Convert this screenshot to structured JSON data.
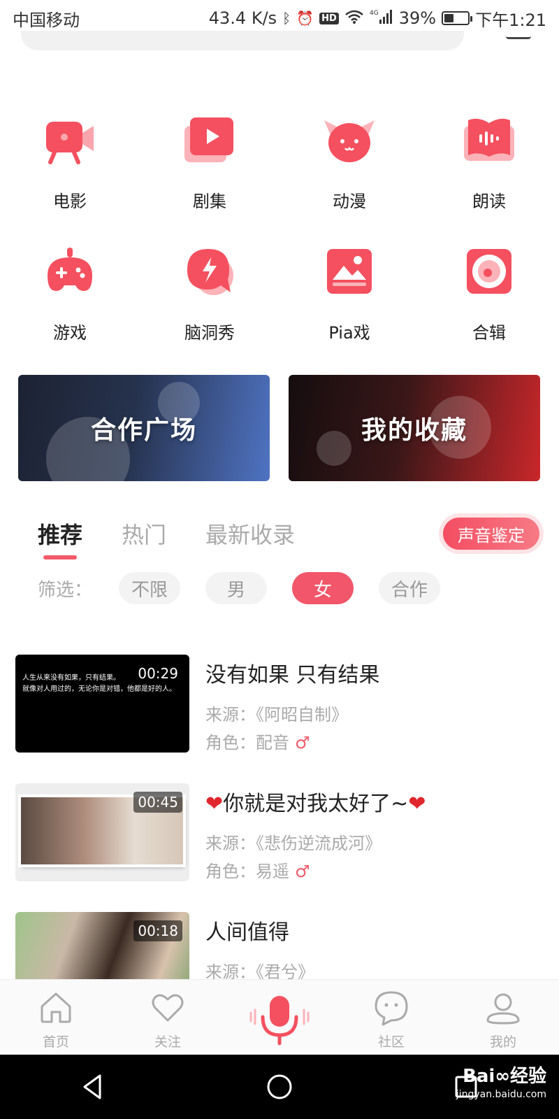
{
  "status_bar": {
    "carrier": "中国移动",
    "speed": "43.4 K/s",
    "hd": "HD",
    "signal_type": "4G",
    "battery": "39%",
    "battery_level": 0.39,
    "time": "下午1:21"
  },
  "categories": [
    {
      "label": "电影",
      "icon": "movie-camera-icon"
    },
    {
      "label": "剧集",
      "icon": "play-icon"
    },
    {
      "label": "动漫",
      "icon": "cat-face-icon"
    },
    {
      "label": "朗读",
      "icon": "book-audio-icon"
    },
    {
      "label": "游戏",
      "icon": "gamepad-icon"
    },
    {
      "label": "脑洞秀",
      "icon": "lightning-bubble-icon"
    },
    {
      "label": "Pia戏",
      "icon": "picture-icon"
    },
    {
      "label": "合辑",
      "icon": "disc-icon"
    }
  ],
  "banners": {
    "cooperation": "合作广场",
    "favorites": "我的收藏"
  },
  "tabs": [
    "推荐",
    "热门",
    "最新收录"
  ],
  "active_tab": 0,
  "voice_button": "声音鉴定",
  "filter": {
    "label": "筛选：",
    "options": [
      "不限",
      "男",
      "女",
      "合作"
    ],
    "selected": 2
  },
  "items": [
    {
      "title": "没有如果 只有结果",
      "duration": "00:29",
      "source": "来源：《阿昭自制》",
      "role": "角色：配音",
      "gender": "♂",
      "thumb_caption_1": "人生从来没有如果，只有结果。",
      "thumb_caption_2": "就像对人用过的，无论你是对错，他都是好的人。"
    },
    {
      "title_prefix": "❤",
      "title": "你就是对我太好了~",
      "title_suffix": "❤",
      "duration": "00:45",
      "source": "来源：《悲伤逆流成河》",
      "role": "角色：易遥",
      "gender": "♂"
    },
    {
      "title": "人间值得",
      "duration": "00:18",
      "source": "来源：《君兮》"
    }
  ],
  "bottom_nav": {
    "home": "首页",
    "follow": "关注",
    "community": "社区",
    "mine": "我的"
  },
  "watermark": {
    "brand": "Bai∞经验",
    "url": "jingyan.baidu.com"
  },
  "colors": {
    "accent": "#f25a6b",
    "accent_dark": "#f44d62"
  }
}
